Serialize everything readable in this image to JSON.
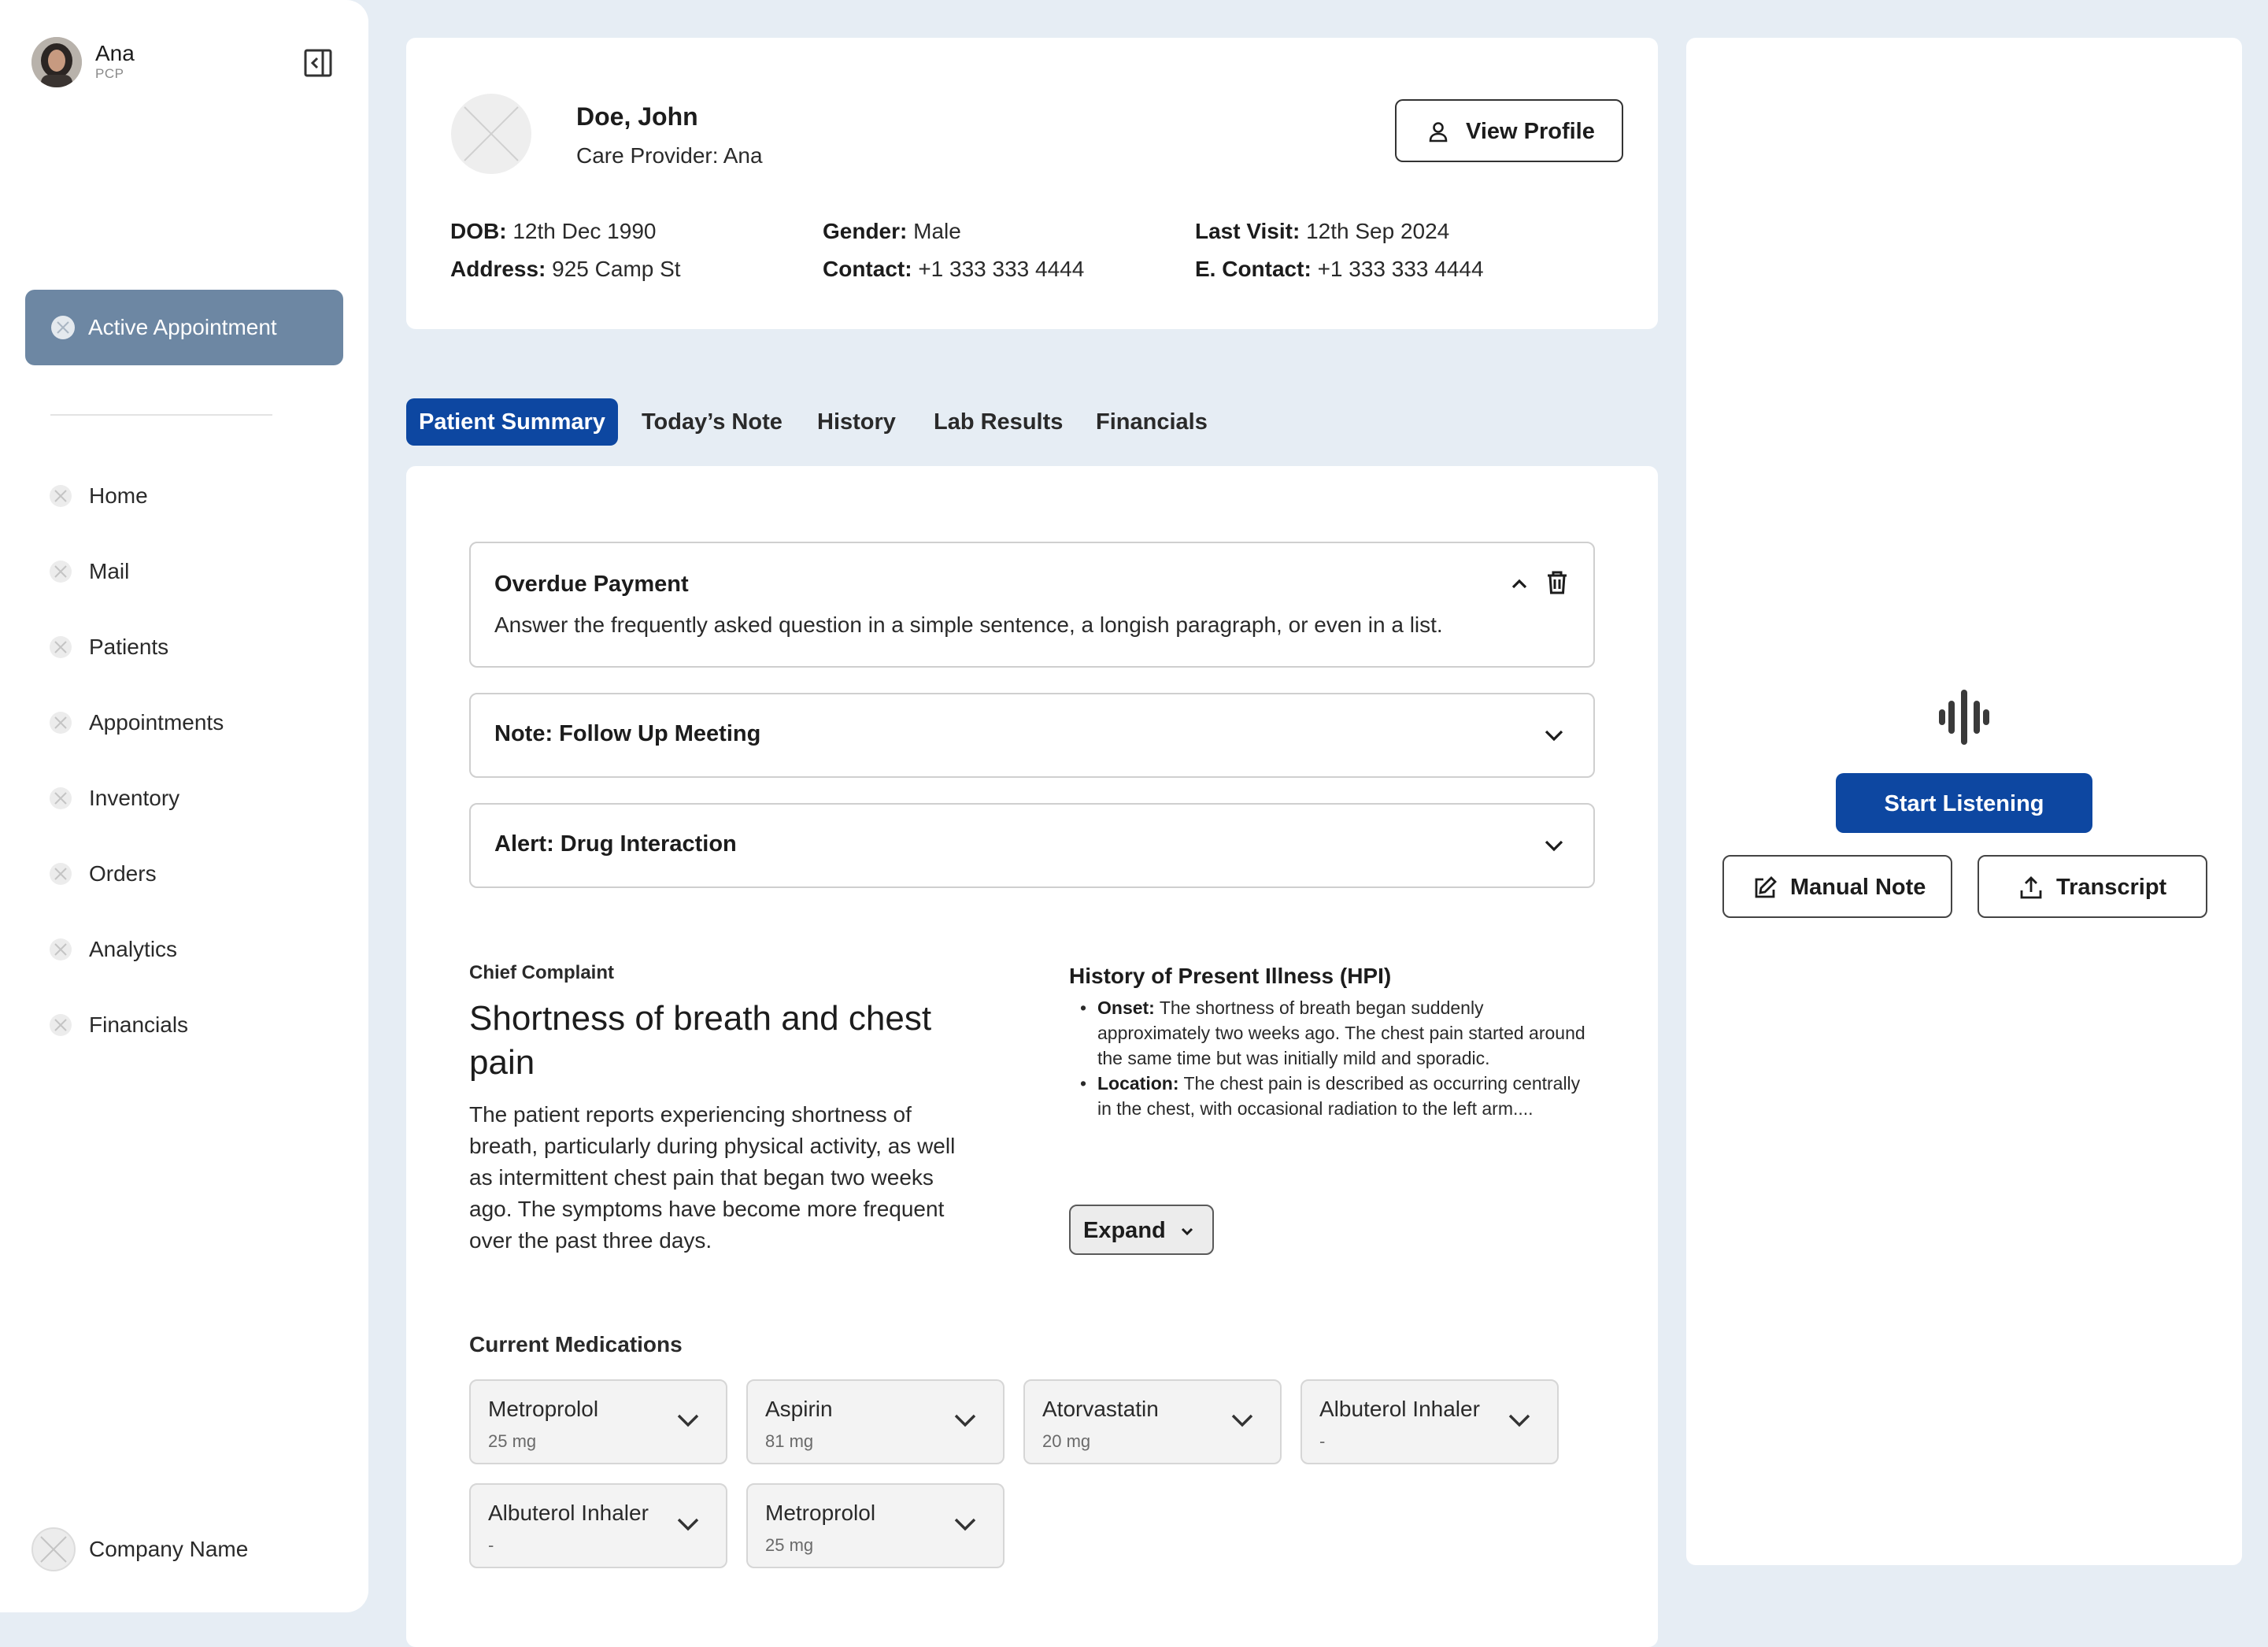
{
  "user": {
    "name": "Ana",
    "role": "PCP"
  },
  "sidebar": {
    "active_appointment": "Active Appointment",
    "items": [
      {
        "label": "Home"
      },
      {
        "label": "Mail"
      },
      {
        "label": "Patients"
      },
      {
        "label": "Appointments"
      },
      {
        "label": "Inventory"
      },
      {
        "label": "Orders"
      },
      {
        "label": "Analytics"
      },
      {
        "label": "Financials"
      }
    ],
    "company_name": "Company Name"
  },
  "patient": {
    "name": "Doe, John",
    "care_provider": "Care Provider: Ana",
    "view_profile": "View Profile",
    "dob_label": "DOB:",
    "dob": "12th Dec 1990",
    "address_label": "Address:",
    "address": "925 Camp St",
    "gender_label": "Gender:",
    "gender": "Male",
    "contact_label": "Contact:",
    "contact": "+1 333 333 4444",
    "last_visit_label": "Last Visit:",
    "last_visit": "12th Sep 2024",
    "e_contact_label": "E. Contact:",
    "e_contact": "+1 333 333 4444"
  },
  "tabs": [
    {
      "label": "Patient Summary",
      "active": true
    },
    {
      "label": "Today’s Note",
      "active": false
    },
    {
      "label": "History",
      "active": false
    },
    {
      "label": "Lab Results",
      "active": false
    },
    {
      "label": "Financials",
      "active": false
    }
  ],
  "accordions": [
    {
      "title": "Overdue Payment",
      "body": "Answer the frequently asked question in a simple sentence, a longish paragraph, or even in a list.",
      "expanded": true
    },
    {
      "title": "Note: Follow Up Meeting",
      "expanded": false
    },
    {
      "title": "Alert: Drug Interaction",
      "expanded": false
    }
  ],
  "chief_complaint": {
    "label": "Chief Complaint",
    "title": "Shortness of breath and chest pain",
    "body": "The patient reports experiencing shortness of breath, particularly during physical activity, as well as intermittent chest pain that began two weeks ago. The symptoms have become more frequent over the past three days."
  },
  "hpi": {
    "title": "History of Present Illness (HPI)",
    "items": [
      {
        "label": "Onset:",
        "text": "The shortness of breath began suddenly approximately two weeks ago. The chest pain started around the same time but was initially mild and sporadic."
      },
      {
        "label": "Location:",
        "text": "The chest pain is described as occurring centrally in the chest, with occasional radiation to the left arm...."
      }
    ],
    "expand_label": "Expand"
  },
  "medications": {
    "title": "Current Medications",
    "items": [
      {
        "name": "Metroprolol",
        "dose": "25 mg"
      },
      {
        "name": "Aspirin",
        "dose": "81 mg"
      },
      {
        "name": "Atorvastatin",
        "dose": "20 mg"
      },
      {
        "name": "Albuterol Inhaler",
        "dose": "-"
      },
      {
        "name": "Albuterol Inhaler",
        "dose": "-"
      },
      {
        "name": "Metroprolol",
        "dose": "25 mg"
      }
    ]
  },
  "right_panel": {
    "start_listening": "Start Listening",
    "manual_note": "Manual Note",
    "transcript": "Transcript"
  },
  "colors": {
    "primary": "#0d47a1",
    "active_nav": "#6d87a3",
    "background": "#e6edf4"
  }
}
